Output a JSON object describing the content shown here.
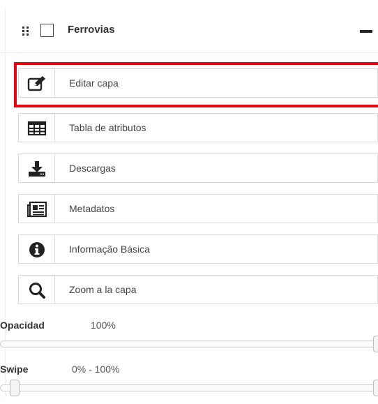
{
  "layer": {
    "title": "Ferrovias",
    "checked": false
  },
  "tools": [
    {
      "label": "Editar capa",
      "icon": "edit-icon"
    },
    {
      "label": "Tabla de atributos",
      "icon": "table-icon"
    },
    {
      "label": "Descargas",
      "icon": "download-icon"
    },
    {
      "label": "Metadatos",
      "icon": "metadata-icon"
    },
    {
      "label": "Informação Básica",
      "icon": "info-icon"
    },
    {
      "label": "Zoom a la capa",
      "icon": "zoom-icon"
    }
  ],
  "opacity": {
    "label": "Opacidad",
    "value": "100%",
    "level": 1.0
  },
  "swipe": {
    "label": "Swipe",
    "value": "0% - 100%",
    "range": [
      0.0,
      1.0
    ]
  },
  "colors": {
    "highlight": "#e30613",
    "icon": "#222222"
  }
}
